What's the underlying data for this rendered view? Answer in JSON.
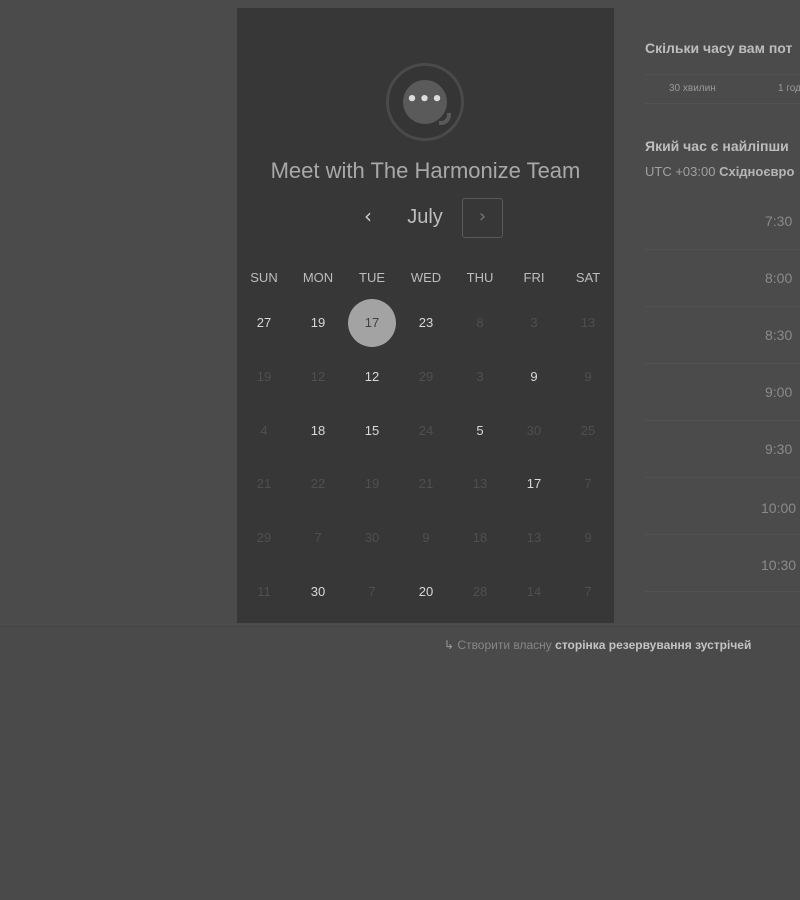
{
  "calendar": {
    "title": "Meet with The Harmonize Team",
    "month": "July",
    "prev_glyph": "‹",
    "next_glyph": "›",
    "logo_dots": "•••",
    "weekdays": [
      "SUN",
      "MON",
      "TUE",
      "WED",
      "THU",
      "FRI",
      "SAT"
    ],
    "weeks": [
      [
        {
          "d": "27",
          "s": "active"
        },
        {
          "d": "19",
          "s": "active"
        },
        {
          "d": "17",
          "s": "selected"
        },
        {
          "d": "23",
          "s": "active"
        },
        {
          "d": "8",
          "s": "dim"
        },
        {
          "d": "3",
          "s": "dim"
        },
        {
          "d": "13",
          "s": "dim"
        }
      ],
      [
        {
          "d": "19",
          "s": "dim"
        },
        {
          "d": "12",
          "s": "dim"
        },
        {
          "d": "12",
          "s": "active"
        },
        {
          "d": "29",
          "s": "dim"
        },
        {
          "d": "3",
          "s": "dim"
        },
        {
          "d": "9",
          "s": "active"
        },
        {
          "d": "9",
          "s": "dim"
        }
      ],
      [
        {
          "d": "4",
          "s": "dim"
        },
        {
          "d": "18",
          "s": "active"
        },
        {
          "d": "15",
          "s": "active"
        },
        {
          "d": "24",
          "s": "dim"
        },
        {
          "d": "5",
          "s": "active"
        },
        {
          "d": "30",
          "s": "dim"
        },
        {
          "d": "25",
          "s": "dim"
        }
      ],
      [
        {
          "d": "21",
          "s": "dim"
        },
        {
          "d": "22",
          "s": "dim"
        },
        {
          "d": "19",
          "s": "dim"
        },
        {
          "d": "21",
          "s": "dim"
        },
        {
          "d": "13",
          "s": "dim"
        },
        {
          "d": "17",
          "s": "active"
        },
        {
          "d": "7",
          "s": "dim"
        }
      ],
      [
        {
          "d": "29",
          "s": "dim"
        },
        {
          "d": "7",
          "s": "dim"
        },
        {
          "d": "30",
          "s": "dim"
        },
        {
          "d": "9",
          "s": "dim"
        },
        {
          "d": "18",
          "s": "dim"
        },
        {
          "d": "13",
          "s": "dim"
        },
        {
          "d": "9",
          "s": "dim"
        }
      ],
      [
        {
          "d": "11",
          "s": "dim"
        },
        {
          "d": "30",
          "s": "active"
        },
        {
          "d": "7",
          "s": "dim"
        },
        {
          "d": "20",
          "s": "active"
        },
        {
          "d": "28",
          "s": "dim"
        },
        {
          "d": "14",
          "s": "dim"
        },
        {
          "d": "7",
          "s": "dim"
        }
      ]
    ]
  },
  "booking": {
    "duration_question": "Скільки часу вам пот",
    "durations": [
      "30 хвилин",
      "1 год"
    ],
    "time_question": "Який час є найліпши",
    "timezone_offset": "UTC +03:00",
    "timezone_name": "Східноєвро",
    "slots": [
      "7:30",
      "8:00",
      "8:30",
      "9:00",
      "9:30",
      "10:00",
      "10:30"
    ]
  },
  "footer": {
    "icon": "↳",
    "text": "Створити власну",
    "link": "сторінка резервування зустрічей"
  }
}
